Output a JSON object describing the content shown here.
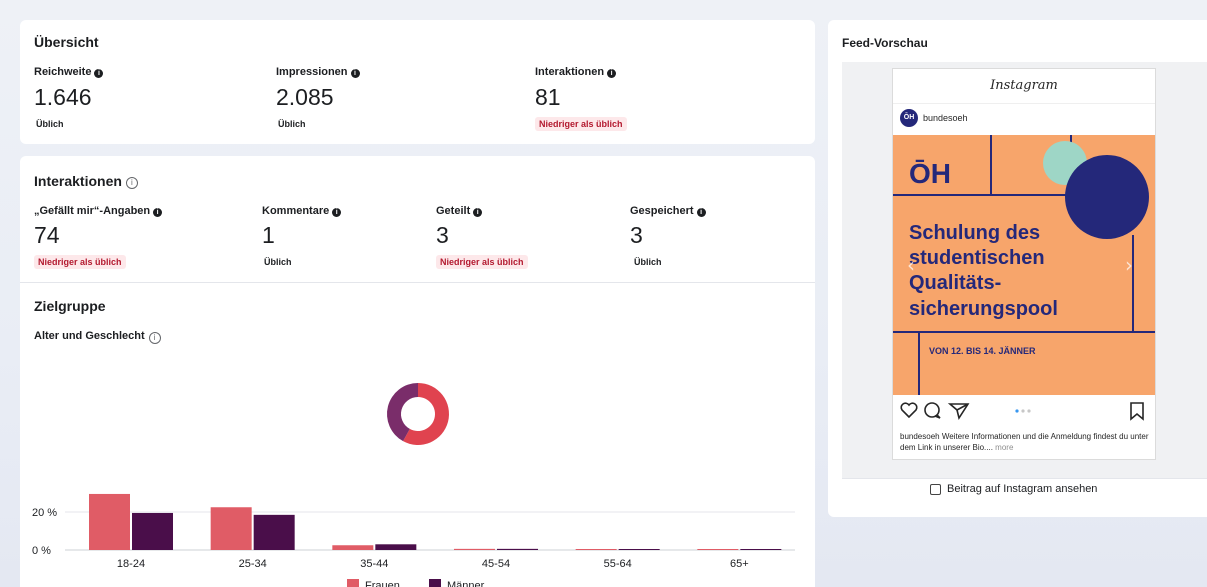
{
  "overview": {
    "title": "Übersicht",
    "metrics": [
      {
        "label": "Reichweite",
        "value": "1.646",
        "status": "Üblich",
        "status_type": "ok"
      },
      {
        "label": "Impressionen",
        "value": "2.085",
        "status": "Üblich",
        "status_type": "ok"
      },
      {
        "label": "Interaktionen",
        "value": "81",
        "status": "Niedriger als üblich",
        "status_type": "low"
      }
    ]
  },
  "interactions": {
    "title": "Interaktionen",
    "metrics": [
      {
        "label": "„Gefällt mir“-Angaben",
        "value": "74",
        "status": "Niedriger als üblich",
        "status_type": "low"
      },
      {
        "label": "Kommentare",
        "value": "1",
        "status": "Üblich",
        "status_type": "ok"
      },
      {
        "label": "Geteilt",
        "value": "3",
        "status": "Niedriger als üblich",
        "status_type": "low"
      },
      {
        "label": "Gespeichert",
        "value": "3",
        "status": "Üblich",
        "status_type": "ok"
      }
    ]
  },
  "audience": {
    "title": "Zielgruppe",
    "subtitle": "Alter und Geschlecht"
  },
  "chart_data": [
    {
      "type": "pie",
      "donut": true,
      "slices": [
        {
          "label": "Frauen",
          "value": 58,
          "color": "#e0434f"
        },
        {
          "label": "Männer",
          "value": 42,
          "color": "#7a2d6a"
        }
      ]
    },
    {
      "type": "bar",
      "categories": [
        "18-24",
        "25-34",
        "35-44",
        "45-54",
        "55-64",
        "65+"
      ],
      "series": [
        {
          "name": "Frauen",
          "color": "#e05c66",
          "values": [
            29.5,
            22.5,
            2.5,
            0.6,
            0.3,
            0.3
          ]
        },
        {
          "name": "Männer",
          "color": "#4a0e4a",
          "values": [
            19.5,
            18.5,
            3.0,
            0.6,
            0.3,
            0.3
          ]
        }
      ],
      "yticks": [
        "0 %",
        "20 %"
      ],
      "ylim": [
        0,
        30
      ],
      "grid": true,
      "legend": "bottom"
    }
  ],
  "feed": {
    "title": "Feed-Vorschau",
    "app_name": "Instagram",
    "account": "bundesoeh",
    "post": {
      "headline_lines": [
        "Schulung des",
        "studentischen",
        "Qualitäts-",
        "sicherungspool"
      ],
      "date_line": "VON 12. BIS 14. JÄNNER",
      "logo_text": "ŌH",
      "caption_account": "bundesoeh",
      "caption_text": "Weitere Informationen und die Anmeldung findest du unter dem Link in unserer Bio....",
      "caption_more": "more",
      "colors": {
        "bg": "#f7a56b",
        "navy": "#24287a",
        "mint": "#9ed6c6"
      }
    },
    "link_label": "Beitrag auf Instagram ansehen"
  }
}
